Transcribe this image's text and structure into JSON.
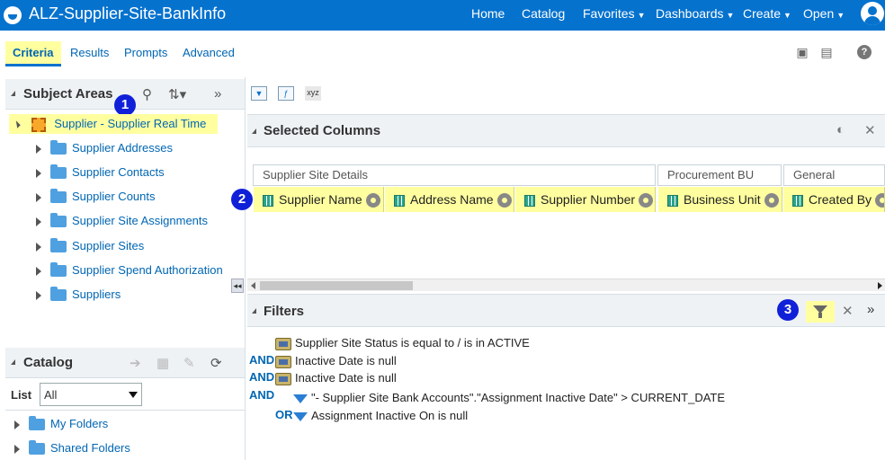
{
  "app": {
    "title": "ALZ-Supplier-Site-BankInfo",
    "nav": [
      "Home",
      "Catalog",
      "Favorites",
      "Dashboards",
      "Create",
      "Open"
    ]
  },
  "tabs": [
    "Criteria",
    "Results",
    "Prompts",
    "Advanced"
  ],
  "subject_areas": {
    "title": "Subject Areas",
    "root": "Supplier - Supplier Real Time",
    "folders": [
      "Supplier Addresses",
      "Supplier Contacts",
      "Supplier Counts",
      "Supplier Site Assignments",
      "Supplier Sites",
      "Supplier Spend Authorization",
      "Suppliers"
    ]
  },
  "catalog": {
    "title": "Catalog",
    "list_label": "List",
    "list_value": "All",
    "folders": [
      "My Folders",
      "Shared Folders"
    ]
  },
  "badges": [
    "1",
    "2",
    "3"
  ],
  "selected_columns": {
    "title": "Selected Columns",
    "groups": [
      "Supplier Site Details",
      "Procurement BU",
      "General"
    ],
    "columns": [
      "Supplier Name",
      "Address Name",
      "Supplier Number",
      "Business Unit",
      "Created By"
    ]
  },
  "filters": {
    "title": "Filters",
    "items": [
      {
        "op": "",
        "text": "Supplier Site Status is equal to / is in  ACTIVE"
      },
      {
        "op": "AND",
        "text": "Inactive Date is null"
      },
      {
        "op": "AND",
        "text": "Inactive Date is null"
      },
      {
        "op": "AND",
        "text": "\"- Supplier Site Bank Accounts\".\"Assignment Inactive Date\" > CURRENT_DATE"
      },
      {
        "op": "OR",
        "text": "Assignment Inactive On is null"
      }
    ]
  },
  "toolbar": {
    "icons": [
      "filter-icon",
      "edit-formula-icon",
      "xyz-icon"
    ]
  },
  "colors": {
    "brand": "#0572ce",
    "highlight": "#ffffa0",
    "badge": "#1020d8"
  }
}
